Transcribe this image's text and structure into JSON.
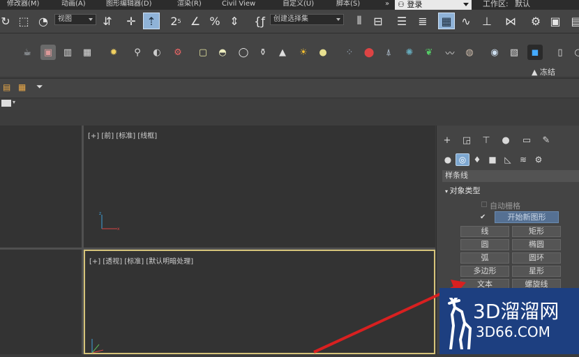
{
  "menu": {
    "items": [
      "修改器(M)",
      "动画(A)",
      "图形编辑器(D)",
      "渲染(R)",
      "Civil View",
      "自定义(U)",
      "脚本(S)"
    ],
    "login": "登录",
    "workspace_label": "工作区:",
    "workspace_value": "默认"
  },
  "toolbar1": {
    "view_dropdown": "视图",
    "selection_set_dropdown": "创建选择集"
  },
  "toolbar2": {
    "freeze_label": "冻结"
  },
  "viewports": {
    "top_label": "[+] [前] [标准] [线框]",
    "bottom_label": "[+] [透视] [标准] [默认明暗处理]"
  },
  "command_panel": {
    "category": "样条线",
    "rollout_title": "对象类型",
    "autogrid_label": "自动栅格",
    "start_new_shape": "开始新图形",
    "object_buttons": [
      "线",
      "矩形",
      "圆",
      "椭圆",
      "弧",
      "圆环",
      "多边形",
      "星形",
      "文本",
      "螺旋线"
    ]
  },
  "watermark": {
    "title": "3D溜溜网",
    "url": "3D66.COM"
  }
}
